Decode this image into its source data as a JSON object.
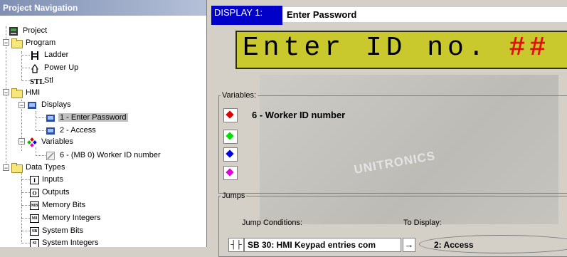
{
  "nav": {
    "title": "Project Navigation",
    "items": {
      "project": "Project",
      "program": "Program",
      "ladder": "Ladder",
      "power_up": "Power Up",
      "stl": "Stl",
      "hmi": "HMI",
      "displays": "Displays",
      "display_1": "1 - Enter Password",
      "display_2": "2 - Access",
      "variables": "Variables",
      "variable_6": "6 - (MB 0)  Worker ID number",
      "data_types": "Data Types",
      "inputs": "Inputs",
      "outputs": "Outputs",
      "memory_bits": "Memory Bits",
      "memory_integers": "Memory Integers",
      "system_bits": "System Bits",
      "system_integers": "System Integers"
    },
    "icons": {
      "ladder": "ladder-icon",
      "power_up": "power-up-icon",
      "stl": "STL",
      "inputs": "I",
      "outputs": "O",
      "memory_bits": "MB",
      "memory_integers": "MI",
      "system_bits": "SB",
      "system_integers": "SI"
    },
    "tree_toggles": {
      "expanded": "−"
    }
  },
  "display": {
    "tab_label": "DISPLAY 1:",
    "name": "Enter Password",
    "lcd_text": "Enter ID no. ",
    "lcd_placeholder": "##",
    "background_logo": "UNITRONICS",
    "colors": {
      "lcd_background": "#c9c92d",
      "tab_background": "#0000c8",
      "placeholder": "#e01010"
    }
  },
  "variables": {
    "legend": "Variables:",
    "rows": [
      {
        "color": "#e00000",
        "label": "6 - Worker ID number"
      },
      {
        "color": "#00e000",
        "label": ""
      },
      {
        "color": "#0000e0",
        "label": ""
      },
      {
        "color": "#e000e0",
        "label": ""
      }
    ]
  },
  "jumps": {
    "legend": "Jumps",
    "conditions_label": "Jump Conditions:",
    "target_label": "To Display:",
    "row": {
      "condition_icon": "┤├",
      "condition": "SB  30: HMI Keypad entries com",
      "arrow": "→",
      "target": "2: Access"
    }
  }
}
